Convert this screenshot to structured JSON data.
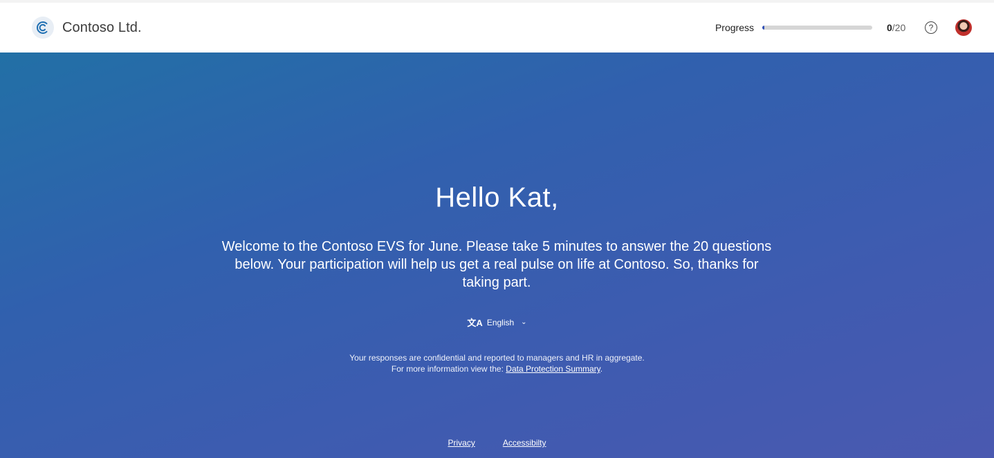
{
  "header": {
    "brand_name": "Contoso Ltd.",
    "logo_icon": "contoso-c-logo",
    "progress_label": "Progress",
    "progress_current": "0",
    "progress_total": "/20",
    "progress_fraction": 0.02,
    "help_glyph": "?",
    "help_icon": "question-circle-icon",
    "avatar_icon": "user-avatar"
  },
  "hero": {
    "greeting": "Hello Kat,",
    "intro": "Welcome to the Contoso EVS for June. Please take 5 minutes to answer the 20 questions below. Your participation will help us get a real pulse on life at Contoso. So, thanks for taking part.",
    "language_glyph": "文A",
    "language_icon": "translate-icon",
    "language": "English",
    "language_chevron": "⌄",
    "notice_line1": "Your responses are confidential and reported to managers and HR in aggregate.",
    "notice_line2_prefix": "For more information view the: ",
    "notice_link": "Data Protection Summary",
    "notice_line2_suffix": "."
  },
  "footer": {
    "privacy": "Privacy",
    "accessibility": "Accessibilty"
  },
  "colors": {
    "accent": "#2f4fb5",
    "hero_top": "#2270a6",
    "hero_bottom": "#4a59b0"
  }
}
